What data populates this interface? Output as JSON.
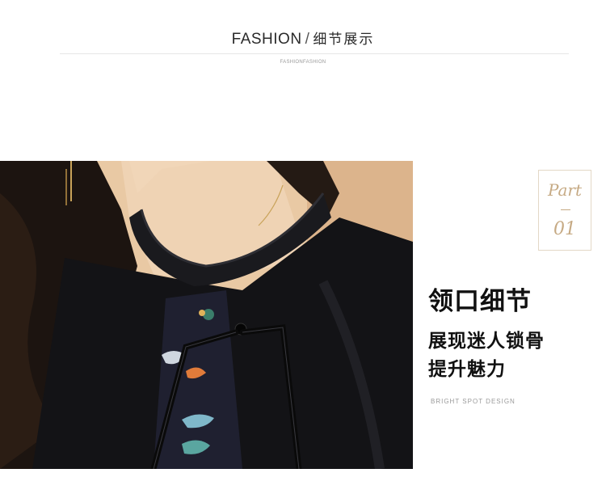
{
  "header": {
    "title_en": "FASHION",
    "separator": "/",
    "title_zh": "细节展示",
    "subtitle": "FASHIONFASHION"
  },
  "part": {
    "label": "Part",
    "number": "01"
  },
  "detail": {
    "title": "领口细节",
    "line1": "展现迷人锁骨",
    "line2": "提升魅力",
    "tag": "BRIGHT SPOT DESIGN"
  },
  "colors": {
    "accent_gold": "#c6aa84",
    "text_dark": "#111111",
    "garment": "#131316",
    "skin": "#e8c9a6"
  }
}
